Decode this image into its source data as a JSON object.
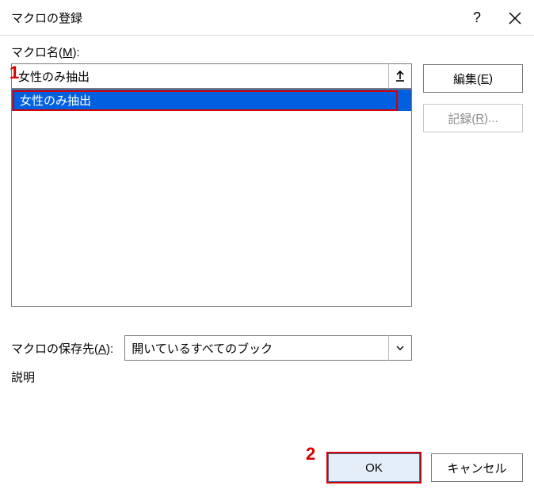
{
  "title": "マクロの登録",
  "help_glyph": "?",
  "labels": {
    "macro_name_pre": "マクロ名(",
    "macro_name_acc": "M",
    "macro_name_post": "):",
    "location_pre": "マクロの保存先(",
    "location_acc": "A",
    "location_post": "):",
    "description": "説明"
  },
  "macro_name_value": "女性のみ抽出",
  "list_items": [
    "女性のみ抽出"
  ],
  "location_value": "開いているすべてのブック",
  "buttons": {
    "edit_pre": "編集(",
    "edit_acc": "E",
    "edit_post": ")",
    "record_pre": "記録(",
    "record_acc": "R",
    "record_post": ")...",
    "ok": "OK",
    "cancel": "キャンセル"
  },
  "annotations": {
    "one": "1",
    "two": "2"
  }
}
